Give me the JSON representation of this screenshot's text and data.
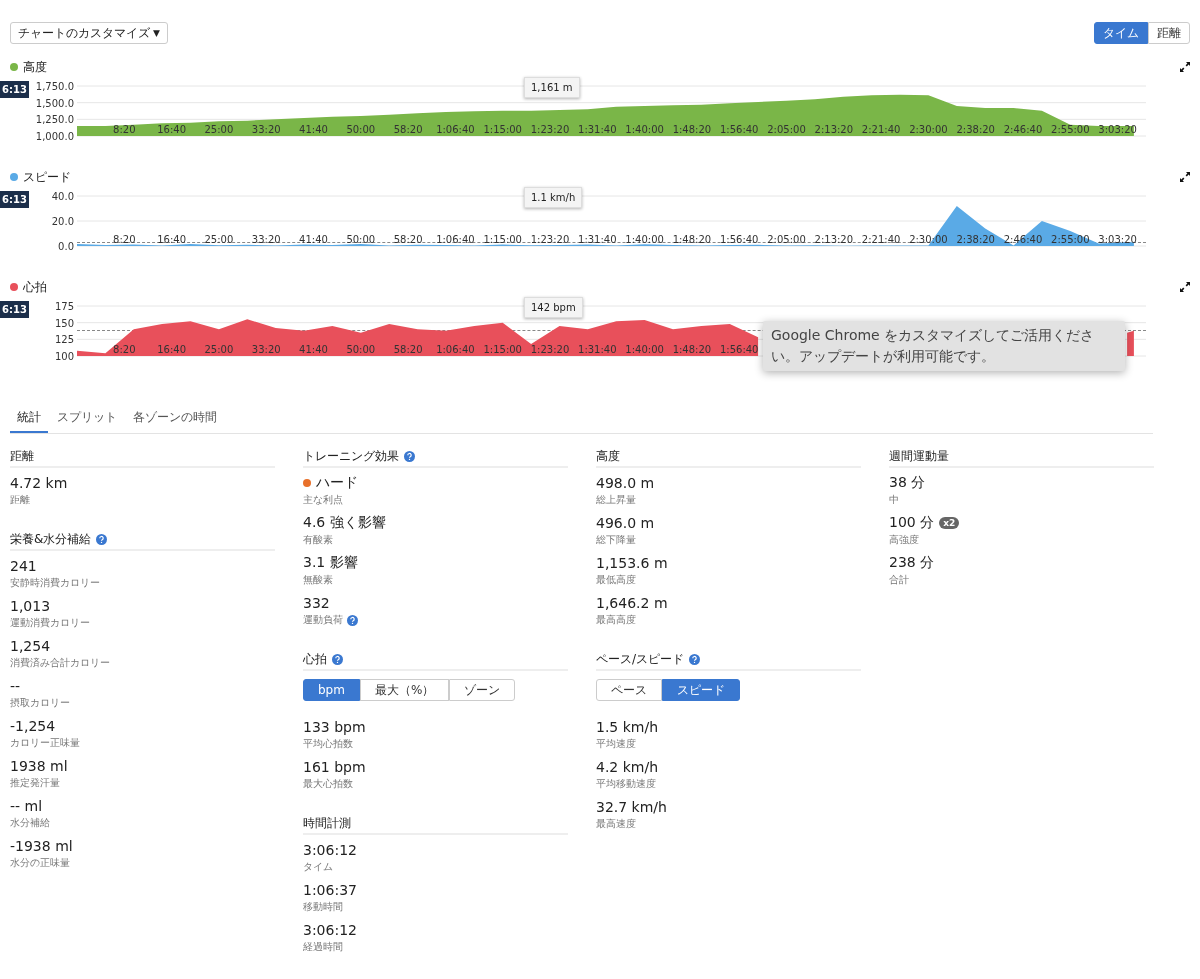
{
  "toolbar": {
    "customize_label": "チャートのカスタマイズ",
    "customize_caret": "▼",
    "axis_toggle": [
      {
        "label": "タイム",
        "selected": true
      },
      {
        "label": "距離",
        "selected": false
      }
    ]
  },
  "charts": [
    {
      "cursor_time": "6:13",
      "tooltip": "1,161 m",
      "chart_data": {
        "type": "area",
        "xlim": [
          0,
          11300
        ],
        "ylim": [
          1000,
          1750
        ],
        "yticks": [
          {
            "value": 1000,
            "label": "1,000.0"
          },
          {
            "value": 1250,
            "label": "1,250.0"
          },
          {
            "value": 1500,
            "label": "1,500.0"
          },
          {
            "value": 1750,
            "label": "1,750.0"
          }
        ],
        "xticks": [
          {
            "value": 500,
            "label": "8:20"
          },
          {
            "value": 1000,
            "label": "16:40"
          },
          {
            "value": 1500,
            "label": "25:00"
          },
          {
            "value": 2000,
            "label": "33:20"
          },
          {
            "value": 2500,
            "label": "41:40"
          },
          {
            "value": 3000,
            "label": "50:00"
          },
          {
            "value": 3500,
            "label": "58:20"
          },
          {
            "value": 4000,
            "label": "1:06:40"
          },
          {
            "value": 4500,
            "label": "1:15:00"
          },
          {
            "value": 5000,
            "label": "1:23:20"
          },
          {
            "value": 5500,
            "label": "1:31:40"
          },
          {
            "value": 6000,
            "label": "1:40:00"
          },
          {
            "value": 6500,
            "label": "1:48:20"
          },
          {
            "value": 7000,
            "label": "1:56:40"
          },
          {
            "value": 7500,
            "label": "2:05:00"
          },
          {
            "value": 8000,
            "label": "2:13:20"
          },
          {
            "value": 8500,
            "label": "2:21:40"
          },
          {
            "value": 9000,
            "label": "2:30:00"
          },
          {
            "value": 9500,
            "label": "2:38:20"
          },
          {
            "value": 10000,
            "label": "2:46:40"
          },
          {
            "value": 10500,
            "label": "2:55:00"
          },
          {
            "value": 11000,
            "label": "3:03:20"
          }
        ],
        "x": [
          0,
          300,
          600,
          900,
          1200,
          1500,
          1800,
          2100,
          2400,
          2700,
          3000,
          3300,
          3600,
          3900,
          4200,
          4500,
          4800,
          5100,
          5400,
          5700,
          6000,
          6300,
          6600,
          6900,
          7200,
          7500,
          7800,
          8100,
          8400,
          8700,
          9000,
          9300,
          9600,
          9900,
          10200,
          10500,
          10800,
          11100,
          11172
        ],
        "series": [
          {
            "name": "高度",
            "color": "#7ab648",
            "values": [
              1150,
              1150,
              1170,
              1190,
              1200,
              1220,
              1230,
              1250,
              1270,
              1290,
              1300,
              1320,
              1340,
              1360,
              1370,
              1380,
              1380,
              1390,
              1400,
              1440,
              1450,
              1460,
              1470,
              1490,
              1510,
              1530,
              1550,
              1590,
              1610,
              1620,
              1610,
              1450,
              1420,
              1420,
              1380,
              1170,
              1150,
              1150,
              1150
            ]
          }
        ]
      }
    },
    {
      "cursor_time": "6:13",
      "tooltip": "1.1 km/h",
      "average_line": true,
      "chart_data": {
        "type": "area",
        "xlim": [
          0,
          11300
        ],
        "ylim": [
          0,
          40
        ],
        "yticks": [
          {
            "value": 0,
            "label": "0.0"
          },
          {
            "value": 20,
            "label": "20.0"
          },
          {
            "value": 40,
            "label": "40.0"
          }
        ],
        "xticks": [
          {
            "value": 500,
            "label": "8:20"
          },
          {
            "value": 1000,
            "label": "16:40"
          },
          {
            "value": 1500,
            "label": "25:00"
          },
          {
            "value": 2000,
            "label": "33:20"
          },
          {
            "value": 2500,
            "label": "41:40"
          },
          {
            "value": 3000,
            "label": "50:00"
          },
          {
            "value": 3500,
            "label": "58:20"
          },
          {
            "value": 4000,
            "label": "1:06:40"
          },
          {
            "value": 4500,
            "label": "1:15:00"
          },
          {
            "value": 5000,
            "label": "1:23:20"
          },
          {
            "value": 5500,
            "label": "1:31:40"
          },
          {
            "value": 6000,
            "label": "1:40:00"
          },
          {
            "value": 6500,
            "label": "1:48:20"
          },
          {
            "value": 7000,
            "label": "1:56:40"
          },
          {
            "value": 7500,
            "label": "2:05:00"
          },
          {
            "value": 8000,
            "label": "2:13:20"
          },
          {
            "value": 8500,
            "label": "2:21:40"
          },
          {
            "value": 9000,
            "label": "2:30:00"
          },
          {
            "value": 9500,
            "label": "2:38:20"
          },
          {
            "value": 10000,
            "label": "2:46:40"
          },
          {
            "value": 10500,
            "label": "2:55:00"
          },
          {
            "value": 11000,
            "label": "3:03:20"
          }
        ],
        "x": [
          0,
          300,
          600,
          900,
          1200,
          1500,
          1800,
          2100,
          2400,
          2700,
          3000,
          3300,
          3600,
          3900,
          4200,
          4500,
          4800,
          5100,
          5400,
          5700,
          6000,
          6300,
          6600,
          6900,
          7200,
          7500,
          7800,
          8100,
          8400,
          8700,
          9000,
          9300,
          9600,
          9900,
          10200,
          10500,
          10800,
          11100,
          11172
        ],
        "series": [
          {
            "name": "スピード",
            "color": "#5aaae6",
            "values": [
              1.5,
              0.8,
              1.2,
              0.5,
              1.5,
              0.6,
              1.0,
              0.4,
              1.2,
              0.8,
              1.5,
              0.5,
              1.0,
              0.7,
              0.4,
              1.1,
              0.6,
              0.9,
              1.3,
              0.5,
              1.4,
              0.8,
              0.3,
              0.9,
              1.0,
              0.4,
              0.6,
              0.2,
              0.5,
              0.3,
              0.4,
              32,
              14,
              0.5,
              20,
              12,
              2,
              3,
              3
            ]
          }
        ]
      }
    },
    {
      "cursor_time": "6:13",
      "tooltip": "142 bpm",
      "average_line": true,
      "chart_data": {
        "type": "area",
        "xlim": [
          0,
          11300
        ],
        "ylim": [
          100,
          175
        ],
        "yticks": [
          {
            "value": 100,
            "label": "100"
          },
          {
            "value": 125,
            "label": "125"
          },
          {
            "value": 150,
            "label": "150"
          },
          {
            "value": 175,
            "label": "175"
          }
        ],
        "xticks": [
          {
            "value": 500,
            "label": "8:20"
          },
          {
            "value": 1000,
            "label": "16:40"
          },
          {
            "value": 1500,
            "label": "25:00"
          },
          {
            "value": 2000,
            "label": "33:20"
          },
          {
            "value": 2500,
            "label": "41:40"
          },
          {
            "value": 3000,
            "label": "50:00"
          },
          {
            "value": 3500,
            "label": "58:20"
          },
          {
            "value": 4000,
            "label": "1:06:40"
          },
          {
            "value": 4500,
            "label": "1:15:00"
          },
          {
            "value": 5000,
            "label": "1:23:20"
          },
          {
            "value": 5500,
            "label": "1:31:40"
          },
          {
            "value": 6000,
            "label": "1:40:00"
          },
          {
            "value": 6500,
            "label": "1:48:20"
          },
          {
            "value": 7000,
            "label": "1:56:40"
          }
        ],
        "x": [
          0,
          300,
          600,
          900,
          1200,
          1500,
          1800,
          2100,
          2400,
          2700,
          3000,
          3300,
          3600,
          3900,
          4200,
          4500,
          4800,
          5100,
          5400,
          5700,
          6000,
          6300,
          6600,
          6900,
          7200,
          7500,
          7800,
          8100,
          8400,
          8700,
          9000,
          9300,
          9600,
          9900,
          10200,
          10500,
          10800,
          11100,
          11172
        ],
        "series": [
          {
            "name": "心拍",
            "color": "#e8505b",
            "values": [
              108,
              104,
              140,
              148,
              152,
              140,
              155,
              142,
              138,
              145,
              135,
              148,
              140,
              138,
              145,
              150,
              118,
              145,
              140,
              152,
              154,
              140,
              145,
              148,
              128,
              null,
              null,
              null,
              null,
              null,
              null,
              null,
              null,
              null,
              null,
              null,
              null,
              135,
              138
            ]
          }
        ]
      }
    }
  ],
  "notification": {
    "text": "Google Chrome をカスタマイズしてご活用ください。アップデートが利用可能です。"
  },
  "tabs": [
    {
      "label": "統計",
      "selected": true
    },
    {
      "label": "スプリット",
      "selected": false
    },
    {
      "label": "各ゾーンの時間",
      "selected": false
    }
  ],
  "stat_columns": [
    [
      {
        "title": "距離",
        "help": false,
        "items": [
          {
            "value": "4.72 km",
            "label": "距離"
          }
        ]
      },
      {
        "title": "栄養&水分補給",
        "help": true,
        "items": [
          {
            "value": "241",
            "label": "安静時消費カロリー"
          },
          {
            "value": "1,013",
            "label": "運動消費カロリー"
          },
          {
            "value": "1,254",
            "label": "消費済み合計カロリー"
          },
          {
            "value": "--",
            "label": "摂取カロリー"
          },
          {
            "value": "-1,254",
            "label": "カロリー正味量"
          },
          {
            "value": "1938 ml",
            "label": "推定発汗量"
          },
          {
            "value": "-- ml",
            "label": "水分補給"
          },
          {
            "value": "-1938 ml",
            "label": "水分の正味量"
          }
        ]
      }
    ],
    [
      {
        "title": "トレーニング効果",
        "help": true,
        "items": [
          {
            "value": "ハード",
            "label": "主な利点",
            "color": "#e8702a"
          },
          {
            "value": "4.6 強く影響",
            "label": "有酸素"
          },
          {
            "value": "3.1 影響",
            "label": "無酸素"
          },
          {
            "value": "332",
            "label": "運動負荷",
            "help": true
          }
        ]
      },
      {
        "title": "心拍",
        "help": true,
        "segments": [
          {
            "label": "bpm",
            "selected": true
          },
          {
            "label": "最大（%）",
            "selected": false
          },
          {
            "label": "ゾーン",
            "selected": false
          }
        ],
        "items": [
          {
            "value": "133 bpm",
            "label": "平均心拍数"
          },
          {
            "value": "161 bpm",
            "label": "最大心拍数"
          }
        ]
      },
      {
        "title": "時間計測",
        "help": false,
        "items": [
          {
            "value": "3:06:12",
            "label": "タイム"
          },
          {
            "value": "1:06:37",
            "label": "移動時間"
          },
          {
            "value": "3:06:12",
            "label": "経過時間"
          }
        ]
      }
    ],
    [
      {
        "title": "高度",
        "help": false,
        "items": [
          {
            "value": "498.0 m",
            "label": "総上昇量"
          },
          {
            "value": "496.0 m",
            "label": "総下降量"
          },
          {
            "value": "1,153.6 m",
            "label": "最低高度"
          },
          {
            "value": "1,646.2 m",
            "label": "最高高度"
          }
        ]
      },
      {
        "title": "ペース/スピード",
        "help": true,
        "segments": [
          {
            "label": "ペース",
            "selected": false
          },
          {
            "label": "スピード",
            "selected": true
          }
        ],
        "items": [
          {
            "value": "1.5 km/h",
            "label": "平均速度"
          },
          {
            "value": "4.2 km/h",
            "label": "平均移動速度"
          },
          {
            "value": "32.7 km/h",
            "label": "最高速度"
          }
        ]
      }
    ],
    [
      {
        "title": "週間運動量",
        "help": false,
        "items": [
          {
            "value": "38 分",
            "label": "中"
          },
          {
            "value": "100 分",
            "label": "高強度",
            "badge": "x2"
          },
          {
            "value": "238 分",
            "label": "合計"
          }
        ]
      }
    ]
  ]
}
